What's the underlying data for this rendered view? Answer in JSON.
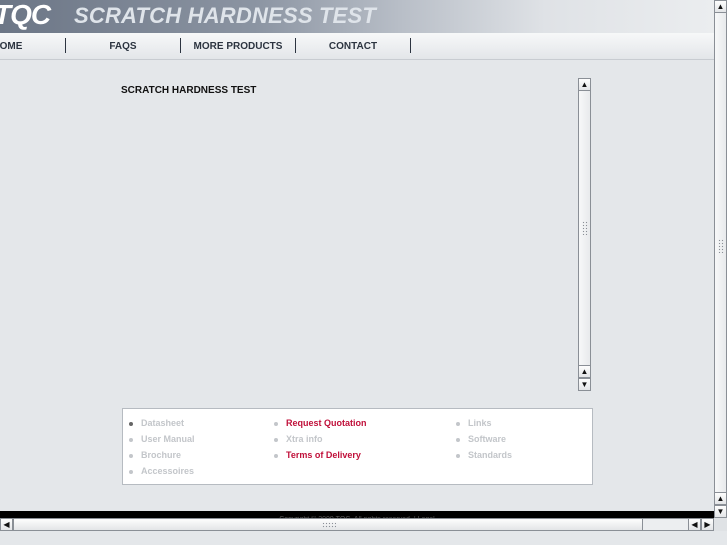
{
  "header": {
    "logo": "TQC",
    "title": "SCRATCH HARDNESS TEST"
  },
  "nav": {
    "items": [
      {
        "label": "OME"
      },
      {
        "label": "FAQS"
      },
      {
        "label": "MORE PRODUCTS"
      },
      {
        "label": "CONTACT"
      }
    ]
  },
  "content": {
    "title": "SCRATCH HARDNESS TEST"
  },
  "links": {
    "col1": [
      "Datasheet",
      "User Manual",
      "Brochure",
      "Accessoires"
    ],
    "col2": [
      "Request Quotation",
      "Xtra info",
      "Terms of Delivery"
    ],
    "col3": [
      "Links",
      "Software",
      "Standards"
    ]
  },
  "footer": {
    "copyright": "Copyright © 2009 TQC. All rights reserved. | Legal"
  },
  "icons": {
    "scroll_up": "▲",
    "scroll_down": "▼",
    "scroll_left": "◀",
    "scroll_right": "▶"
  },
  "colors": {
    "active_link": "#c0103a",
    "inactive_link": "#c3c6ca"
  }
}
